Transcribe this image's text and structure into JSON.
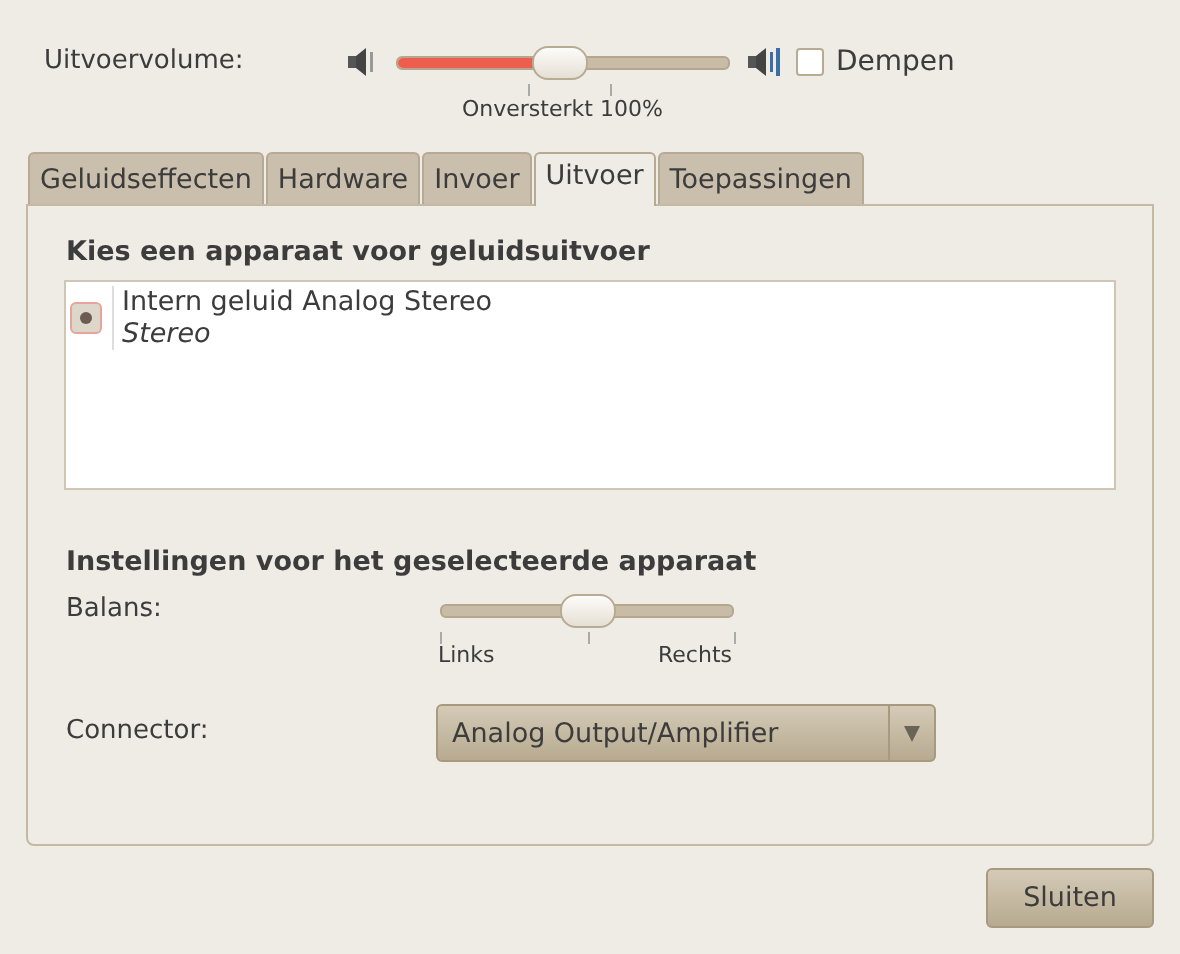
{
  "volume": {
    "label": "Uitvoervolume:",
    "level": 0.49,
    "mark_label": "Onversterkt 100%",
    "mute": {
      "label": "Dempen",
      "checked": false
    }
  },
  "tabs": [
    {
      "label": "Geluidseffecten",
      "selected": false
    },
    {
      "label": "Hardware",
      "selected": false
    },
    {
      "label": "Invoer",
      "selected": false
    },
    {
      "label": "Uitvoer",
      "selected": true
    },
    {
      "label": "Toepassingen",
      "selected": false
    }
  ],
  "device_section": {
    "heading": "Kies een apparaat voor geluidsuitvoer",
    "devices": [
      {
        "name": "Intern geluid Analog Stereo",
        "profile": "Stereo",
        "selected": true
      }
    ]
  },
  "settings_section": {
    "heading": "Instellingen voor het geselecteerde apparaat",
    "balance": {
      "label": "Balans:",
      "level": 0.5,
      "left_label": "Links",
      "right_label": "Rechts"
    },
    "connector": {
      "label": "Connector:",
      "value": "Analog Output/Amplifier"
    }
  },
  "buttons": [
    {
      "label": "Sluiten"
    }
  ]
}
